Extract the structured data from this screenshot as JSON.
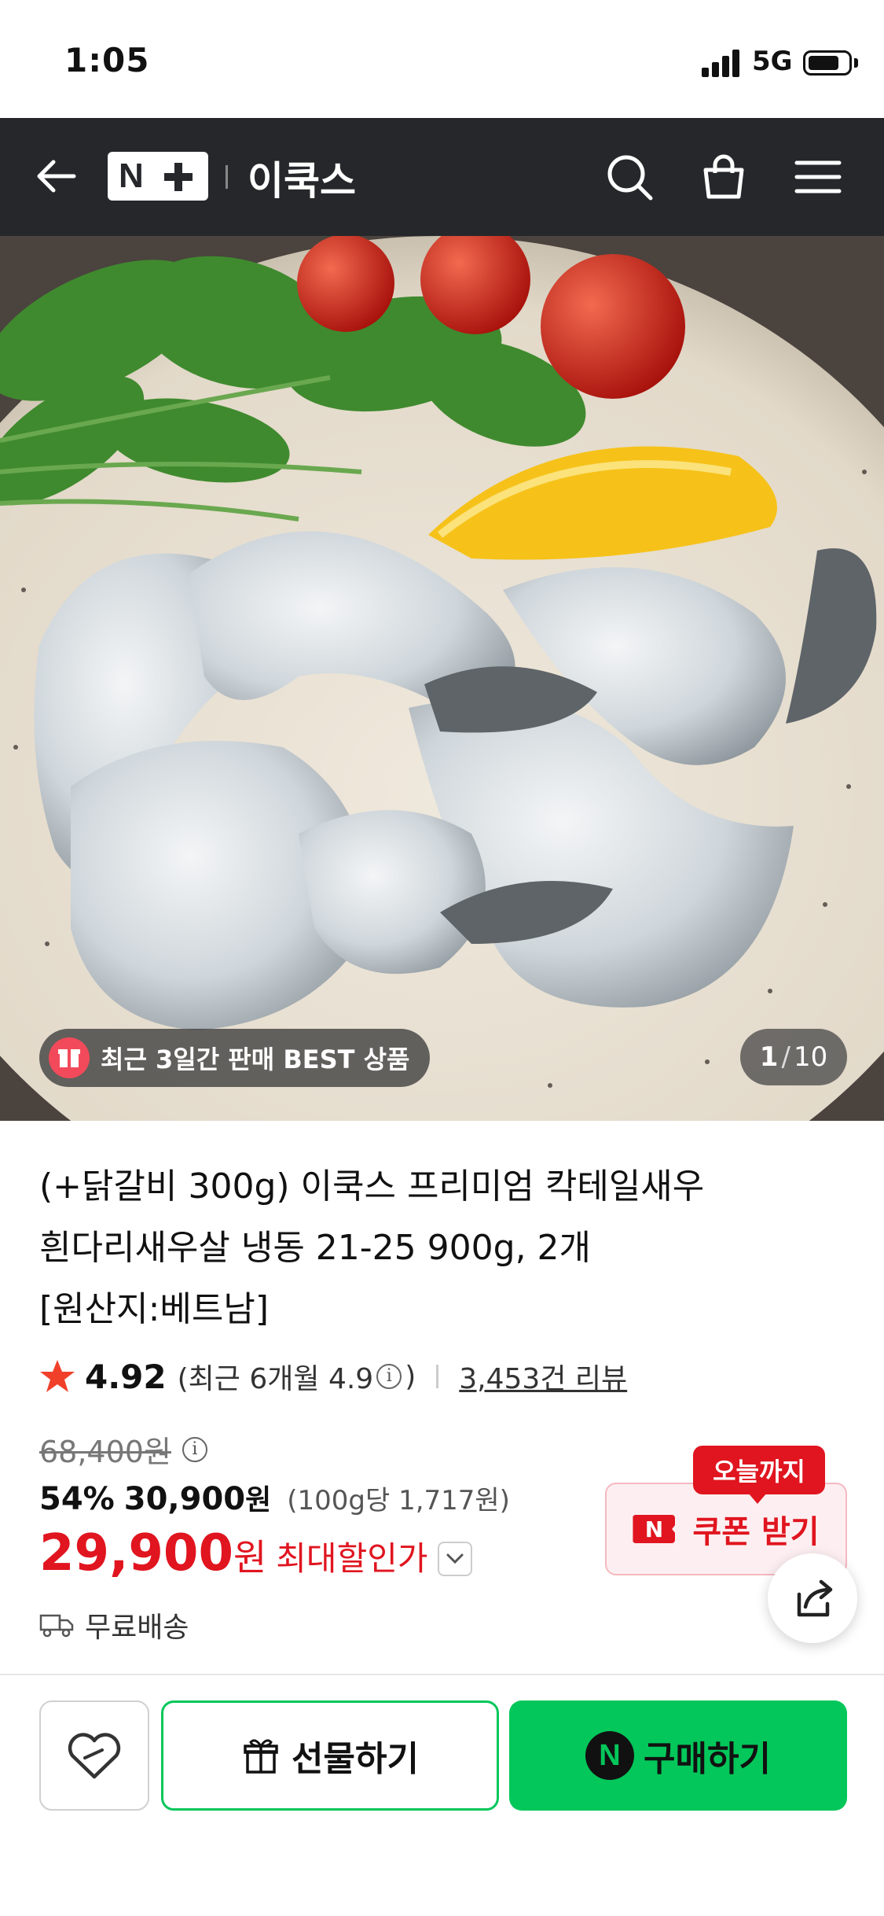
{
  "status_bar": {
    "time": "1:05",
    "network": "5G"
  },
  "nav": {
    "logo_text": "N",
    "brand": "이쿡스",
    "icons": [
      "back-arrow-icon",
      "search-icon",
      "cart-icon",
      "menu-icon"
    ]
  },
  "hero": {
    "badge": "최근 3일간 판매 BEST 상품",
    "counter_current": "1",
    "counter_sep": "/",
    "counter_total": "10"
  },
  "product": {
    "title_line1": "(+닭갈비 300g) 이쿡스 프리미엄 칵테일새우",
    "title_line2": "흰다리새우살 냉동 21-25 900g, 2개",
    "title_line3": "[원산지:베트남]",
    "rating": "4.92",
    "rating_sub_open": "(최근 6개월 4.9",
    "rating_sub_close": ")",
    "reviews": "3,453건 리뷰",
    "original_price": "68,400원",
    "discount_pct": "54%",
    "sale_price": "30,900",
    "sale_won": "원",
    "per_unit": "(100g당 1,717원)",
    "best_price": "29,900",
    "best_won": "원",
    "best_label": "최대할인가",
    "shipping": "무료배송"
  },
  "coupon": {
    "tag": "오늘까지",
    "logo": "N",
    "label": "쿠폰 받기"
  },
  "actions": {
    "gift": "선물하기",
    "buy_logo": "N",
    "buy": "구매하기"
  },
  "colors": {
    "accent_red": "#e0151f",
    "naver_green": "#03c75a",
    "nav_bg": "#25272b"
  }
}
